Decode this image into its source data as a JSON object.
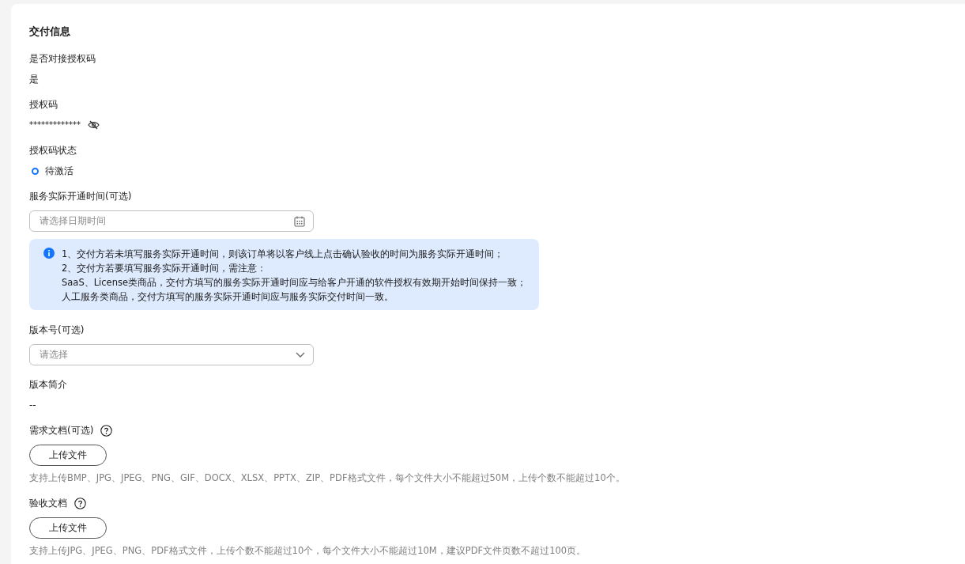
{
  "section": {
    "title": "交付信息"
  },
  "fields": [
    {
      "kind": "text",
      "label": "是否对接授权码",
      "value": "是"
    },
    {
      "kind": "secret",
      "label": "授权码",
      "value": "*************"
    },
    {
      "kind": "radio",
      "label": "授权码状态",
      "options": [
        {
          "label": "待激活",
          "selected": true
        }
      ]
    },
    {
      "kind": "date",
      "label": "服务实际开通时间(可选)",
      "placeholder": "请选择日期时间"
    },
    {
      "kind": "notice",
      "lines": [
        "1、交付方若未填写服务实际开通时间，则该订单将以客户线上点击确认验收的时间为服务实际开通时间；",
        "2、交付方若要填写服务实际开通时间，需注意：",
        "SaaS、License类商品，交付方填写的服务实际开通时间应与给客户开通的软件授权有效期开始时间保持一致；",
        "人工服务类商品，交付方填写的服务实际开通时间应与服务实际交付时间一致。"
      ]
    },
    {
      "kind": "select",
      "label": "版本号(可选)",
      "placeholder": "请选择"
    },
    {
      "kind": "text",
      "label": "版本简介",
      "value": "--"
    },
    {
      "kind": "upload",
      "label": "需求文档(可选)",
      "help": true,
      "button": "上传文件",
      "hint": "支持上传BMP、JPG、JPEG、PNG、GIF、DOCX、XLSX、PPTX、ZIP、PDF格式文件，每个文件大小不能超过50M，上传个数不能超过10个。"
    },
    {
      "kind": "upload",
      "label": "验收文档",
      "help": true,
      "button": "上传文件",
      "hint": "支持上传JPG、JPEG、PNG、PDF格式文件，上传个数不能超过10个，每个文件大小不能超过10M，建议PDF文件页数不超过100页。"
    }
  ]
}
